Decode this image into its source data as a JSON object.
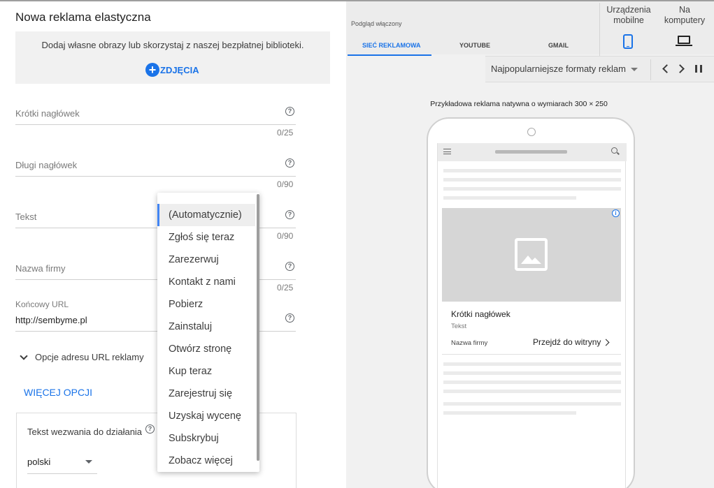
{
  "form": {
    "title": "Nowa reklama elastyczna",
    "image_hint": "Dodaj własne obrazy lub skorzystaj z naszej bezpłatnej biblioteki.",
    "images_button": "ZDJĘCIA",
    "short_headline": {
      "placeholder": "Krótki nagłówek",
      "counter": "0/25"
    },
    "long_headline": {
      "placeholder": "Długi nagłówek",
      "counter": "0/90"
    },
    "description": {
      "placeholder": "Tekst",
      "counter": "0/90"
    },
    "business_name": {
      "placeholder": "Nazwa firmy",
      "counter": "0/25"
    },
    "final_url": {
      "label": "Końcowy URL",
      "value": "http://sembyme.pl"
    },
    "url_options": "Opcje adresu URL reklamy",
    "more_options": "WIĘCEJ OPCJI",
    "cta": {
      "label": "Tekst wezwania do działania",
      "language": "polski"
    },
    "help_glyph": "?"
  },
  "dropdown": {
    "options": [
      "(Automatycznie)",
      "Zgłoś się teraz",
      "Zarezerwuj",
      "Kontakt z nami",
      "Pobierz",
      "Zainstaluj",
      "Otwórz stronę",
      "Kup teraz",
      "Zarejestruj się",
      "Uzyskaj wycenę",
      "Subskrybuj",
      "Zobacz więcej"
    ],
    "selected_index": 0
  },
  "preview": {
    "preview_on": "Podgląd włączony",
    "tabs": [
      "SIEĆ REKLAMOWA",
      "YOUTUBE",
      "GMAIL"
    ],
    "devices": {
      "mobile": "Urządzenia mobilne",
      "desktop": "Na komputery"
    },
    "format_select": "Najpopularniejsze formaty reklam",
    "sample_caption": "Przykładowa reklama natywna o wymiarach 300 × 250",
    "ad": {
      "info_glyph": "i",
      "headline": "Krótki nagłówek",
      "text": "Tekst",
      "business": "Nazwa firmy",
      "cta": "Przejdź do witryny"
    }
  },
  "colors": {
    "accent": "#1a73e8",
    "selection_marker": "#4285f4",
    "panel_bg": "#f1f1f1"
  }
}
